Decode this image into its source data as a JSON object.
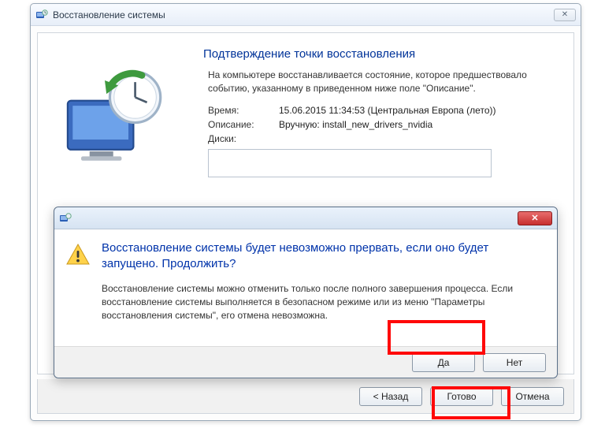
{
  "window": {
    "title": "Восстановление системы"
  },
  "main": {
    "heading": "Подтверждение точки восстановления",
    "description": "На компьютере восстанавливается состояние, которое предшествовало событию, указанному в приведенном ниже поле \"Описание\".",
    "time_label": "Время:",
    "time_value": "15.06.2015 11:34:53 (Центральная Европа (лето))",
    "desc_label": "Описание:",
    "desc_value": "Вручную: install_new_drivers_nvidia",
    "disks_label": "Диски:"
  },
  "footer": {
    "back": "< Назад",
    "finish": "Готово",
    "cancel": "Отмена"
  },
  "dialog": {
    "main_text": "Восстановление системы будет невозможно прервать, если оно будет запущено. Продолжить?",
    "sub_text": "Восстановление системы можно отменить только после полного завершения процесса. Если восстановление системы выполняется в безопасном режиме или из меню \"Параметры восстановления системы\", его отмена невозможна.",
    "yes": "Да",
    "no": "Нет"
  }
}
